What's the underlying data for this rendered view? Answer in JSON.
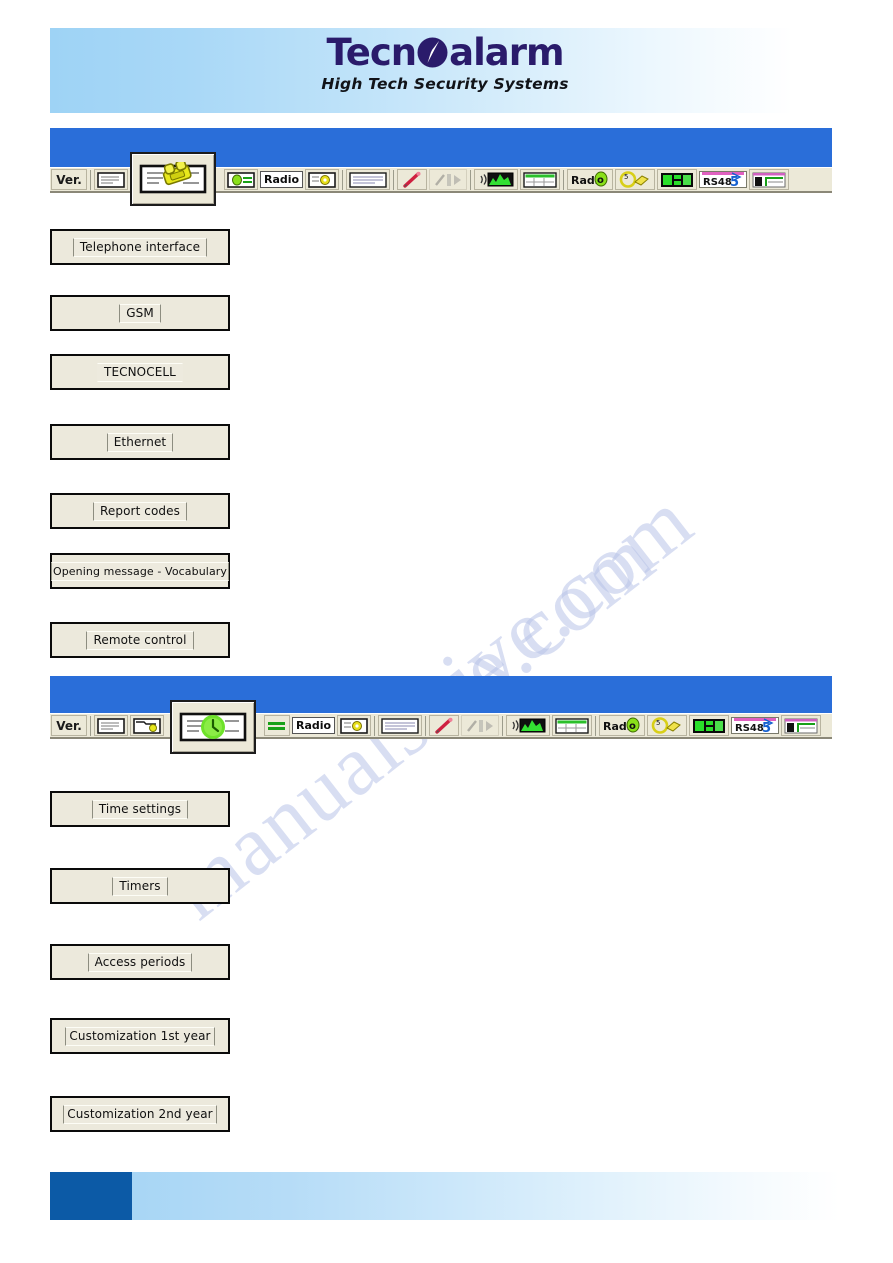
{
  "header": {
    "logo_part1": "Tecn",
    "logo_part2": "alarm",
    "logo_icon": "tecnoalarm-swoosh-icon",
    "tagline": "High Tech Security Systems",
    "logo_color": "#2a1b6b",
    "gradient_start": "#9ed3f5",
    "gradient_end": "#ffffff"
  },
  "sections": [
    {
      "id": "telephone-section",
      "banner_color": "#2a6ed9",
      "toolbar": {
        "version_label": "Ver.",
        "radio_label": "Radio",
        "radio_label2": "Radio",
        "rs485_label": "RS485",
        "active_index": 2,
        "active_icon": "folder-telephone-icon",
        "items": [
          {
            "name": "version-button",
            "icon": "version-text-icon",
            "label": "Ver."
          },
          {
            "name": "new-file-button",
            "icon": "document-blank-icon"
          },
          {
            "name": "open-folder-button",
            "icon": "folder-open-icon"
          },
          {
            "name": "telephone-interface-button",
            "icon": "folder-telephone-icon"
          },
          {
            "name": "zones-button",
            "icon": "folder-green-dot-icon"
          },
          {
            "name": "keypad-button",
            "icon": "folder-green-key-icon"
          },
          {
            "name": "radio-button",
            "icon": "radio-text-icon",
            "label": "Radio"
          },
          {
            "name": "settings-button",
            "icon": "folder-gear-icon"
          },
          {
            "name": "list-button",
            "icon": "list-form-icon"
          },
          {
            "name": "marker-button",
            "icon": "red-pen-icon"
          },
          {
            "name": "tools-disabled-button",
            "icon": "tools-grey-icon"
          },
          {
            "name": "sound-button",
            "icon": "speaker-wave-icon"
          },
          {
            "name": "calendar-button",
            "icon": "calendar-grid-icon"
          },
          {
            "name": "radio2-button",
            "icon": "radio-green-text-icon",
            "label": "Radio"
          },
          {
            "name": "key-timer-button",
            "icon": "yellow-clock-key-icon"
          },
          {
            "name": "display-button",
            "icon": "green-display-icon"
          },
          {
            "name": "rs485-button",
            "icon": "rs485-text-icon",
            "label": "RS485"
          },
          {
            "name": "report-table-button",
            "icon": "table-report-icon"
          }
        ]
      },
      "buttons": [
        {
          "label": "Telephone interface",
          "name": "telephone-interface-option"
        },
        {
          "label": "GSM",
          "name": "gsm-option"
        },
        {
          "label": "TECNOCELL",
          "name": "tecnocell-option"
        },
        {
          "label": "Ethernet",
          "name": "ethernet-option"
        },
        {
          "label": "Report codes",
          "name": "report-codes-option"
        },
        {
          "label": "Opening message - Vocabulary",
          "name": "opening-message-vocabulary-option"
        },
        {
          "label": "Remote control",
          "name": "remote-control-option"
        }
      ]
    },
    {
      "id": "time-section",
      "banner_color": "#2a6ed9",
      "toolbar": {
        "version_label": "Ver.",
        "radio_label": "Radio",
        "radio_label2": "Radio",
        "rs485_label": "RS485",
        "active_index": 3,
        "active_icon": "folder-green-clock-icon"
      },
      "buttons": [
        {
          "label": "Time settings",
          "name": "time-settings-option"
        },
        {
          "label": "Timers",
          "name": "timers-option"
        },
        {
          "label": "Access periods",
          "name": "access-periods-option"
        },
        {
          "label": "Customization 1st year",
          "name": "customization-1st-year-option"
        },
        {
          "label": "Customization 2nd year",
          "name": "customization-2nd-year-option"
        }
      ]
    }
  ],
  "footer": {
    "block_color": "#0c5aa6",
    "gradient_start": "#a8d6f5",
    "gradient_end": "#ffffff"
  },
  "watermark": {
    "line1": "manualshive.com",
    "line2": "e.com"
  }
}
